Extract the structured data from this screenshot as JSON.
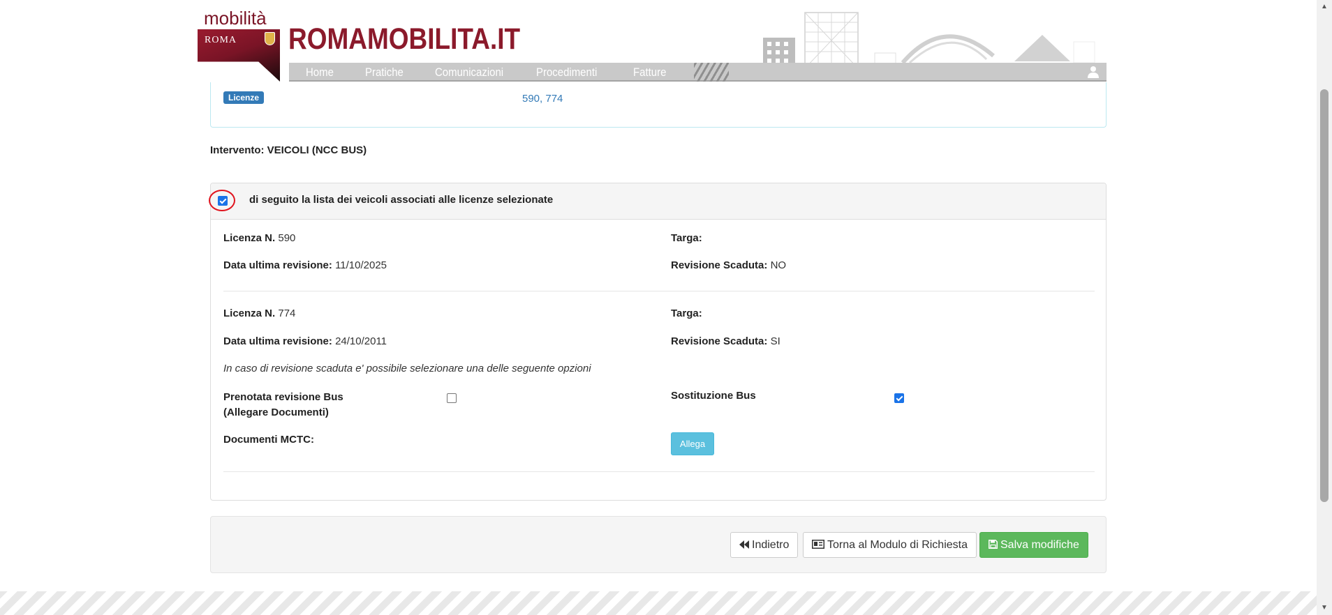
{
  "header": {
    "logo_small": "mobilità",
    "logo_city": "ROMA",
    "brand": "ROMAMOBILITA.IT",
    "nav": [
      "Home",
      "Pratiche",
      "Comunicazioni",
      "Procedimenti",
      "Fatture"
    ],
    "brand_color": "#8b1a2b"
  },
  "licenses": {
    "badge": "Licenze",
    "numbers": "590, 774"
  },
  "intervento": "Intervento: VEICOLI (NCC BUS)",
  "vehicles_panel": {
    "select_all_checked": true,
    "header_text": "di seguito la lista dei veicoli associati alle licenze selezionate",
    "vehicles": [
      {
        "licenza_label": "Licenza N.",
        "licenza": "590",
        "targa_label": "Targa:",
        "data_label": "Data ultima revisione:",
        "data": "11/10/2025",
        "scaduta_label": "Revisione Scaduta:",
        "scaduta": "NO"
      },
      {
        "licenza_label": "Licenza N.",
        "licenza": "774",
        "targa_label": "Targa:",
        "data_label": "Data ultima revisione:",
        "data": "24/10/2011",
        "scaduta_label": "Revisione Scaduta:",
        "scaduta": "SI",
        "note": "In caso di revisione scaduta e' possibile selezionare una delle seguente opzioni",
        "option_prenotata_line1": "Prenotata revisione Bus",
        "option_prenotata_line2": "(Allegare Documenti)",
        "option_prenotata_checked": false,
        "option_sostituzione": "Sostituzione Bus",
        "option_sostituzione_checked": true,
        "documenti_label": "Documenti MCTC:",
        "allega_label": "Allega"
      }
    ]
  },
  "actions": {
    "back": "Indietro",
    "back_icon": "double-chevron-left-icon",
    "return": "Torna al Modulo di Richiesta",
    "return_icon": "id-card-icon",
    "save": "Salva modifiche",
    "save_icon": "floppy-disk-icon",
    "save_color": "#5cb85c"
  }
}
